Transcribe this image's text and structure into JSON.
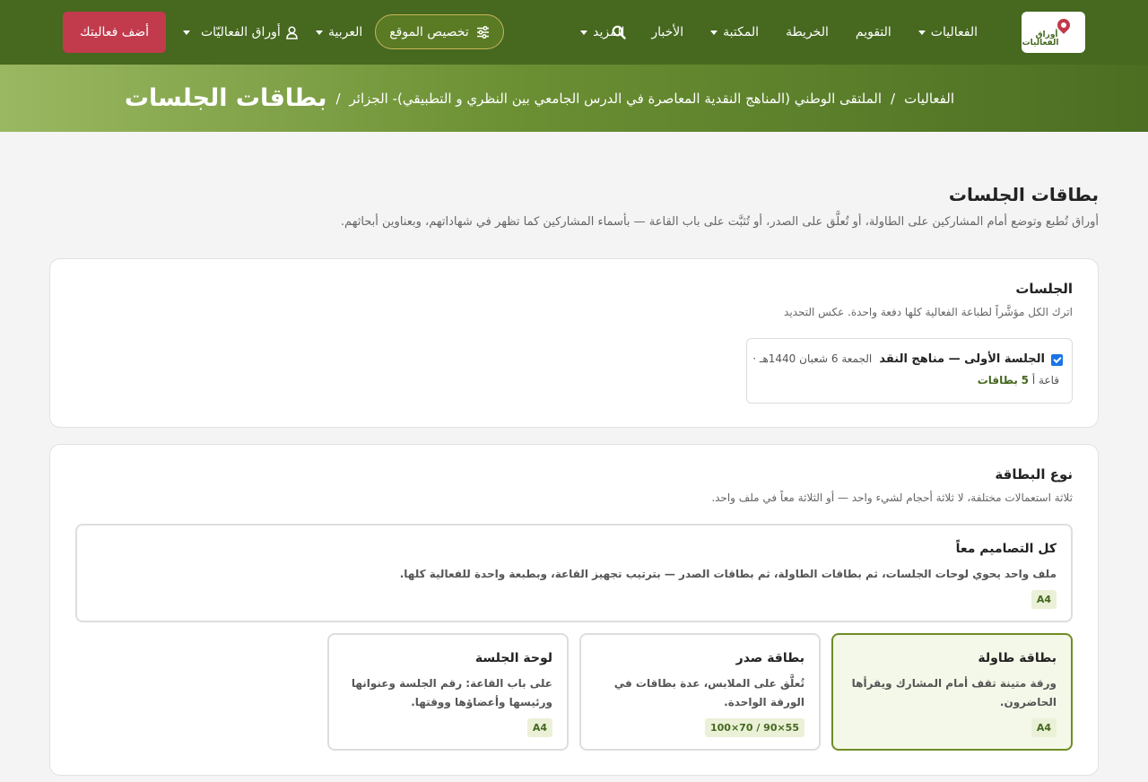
{
  "nav": {
    "logo_text": "أوراق الفعاليات",
    "items": [
      {
        "label": "الفعاليات",
        "dropdown": true
      },
      {
        "label": "التقويم",
        "dropdown": false
      },
      {
        "label": "الخريطة",
        "dropdown": false
      },
      {
        "label": "المكتبة",
        "dropdown": true
      },
      {
        "label": "الأخبار",
        "dropdown": false
      },
      {
        "label": "المزيد",
        "dropdown": true
      }
    ],
    "customize_label": "تخصيص الموقع",
    "language_label": "العربية",
    "account_label": "أوراق الفعاليّات",
    "add_event_label": "أضف فعاليتك"
  },
  "breadcrumb": {
    "items": [
      "الفعاليات",
      "الملتقى الوطني (المناهج النقدية المعاصرة في الدرس الجامعي بين النظري و التطبيقي)- الجزائر"
    ],
    "separator": "/",
    "current": "بطاقات الجلسات"
  },
  "page": {
    "title": "بطاقات الجلسات",
    "subtitle": "أوراق تُطبع وتوضع أمام المشاركين على الطاولة، أو تُعلَّق على الصدر، أو تُثبَّت على باب القاعة — بأسماء المشاركين كما تظهر في شهاداتهم، وبعناوين أبحاثهم."
  },
  "sessions_card": {
    "title": "الجلسات",
    "desc": "اترك الكل مؤشَّراً لطباعة الفعالية كلها دفعة واحدة. عكس التحديد",
    "session": {
      "checked": true,
      "name": "الجلسة الأولى — مناهج النقد",
      "date": "الجمعة 6 شعبان 1440هـ ·",
      "room": "قاعة أ",
      "count": "5",
      "count_label": "بطاقات"
    }
  },
  "type_card": {
    "title": "نوع البطاقة",
    "desc": "ثلاثة استعمالات مختلفة، لا ثلاثة أحجام لشيء واحد — أو الثلاثة معاً في ملف واحد.",
    "all": {
      "title": "كل التصاميم معاً",
      "desc": "ملف واحد يحوي لوحات الجلسات، ثم بطاقات الطاولة، ثم بطاقات الصدر — بترتيب تجهيز القاعة، وبطبعة واحدة للفعالية كلها.",
      "badge": "A4"
    },
    "options": [
      {
        "title": "بطاقة طاولة",
        "desc": "ورقة متينة تقف أمام المشارك ويقرأها الحاضرون.",
        "badge": "A4",
        "selected": true
      },
      {
        "title": "بطاقة صدر",
        "desc": "تُعلَّق على الملابس، عدة بطاقات في الورقة الواحدة.",
        "badge": "100×70 / 90×55",
        "selected": false
      },
      {
        "title": "لوحة الجلسة",
        "desc": "على باب القاعة: رقم الجلسة وعنوانها ورئيسها وأعضاؤها ووقتها.",
        "badge": "A4",
        "selected": false
      }
    ]
  },
  "colors": {
    "nav_bg": "#46681f",
    "accent": "#6e8d26",
    "add_button": "#c13b4d"
  }
}
